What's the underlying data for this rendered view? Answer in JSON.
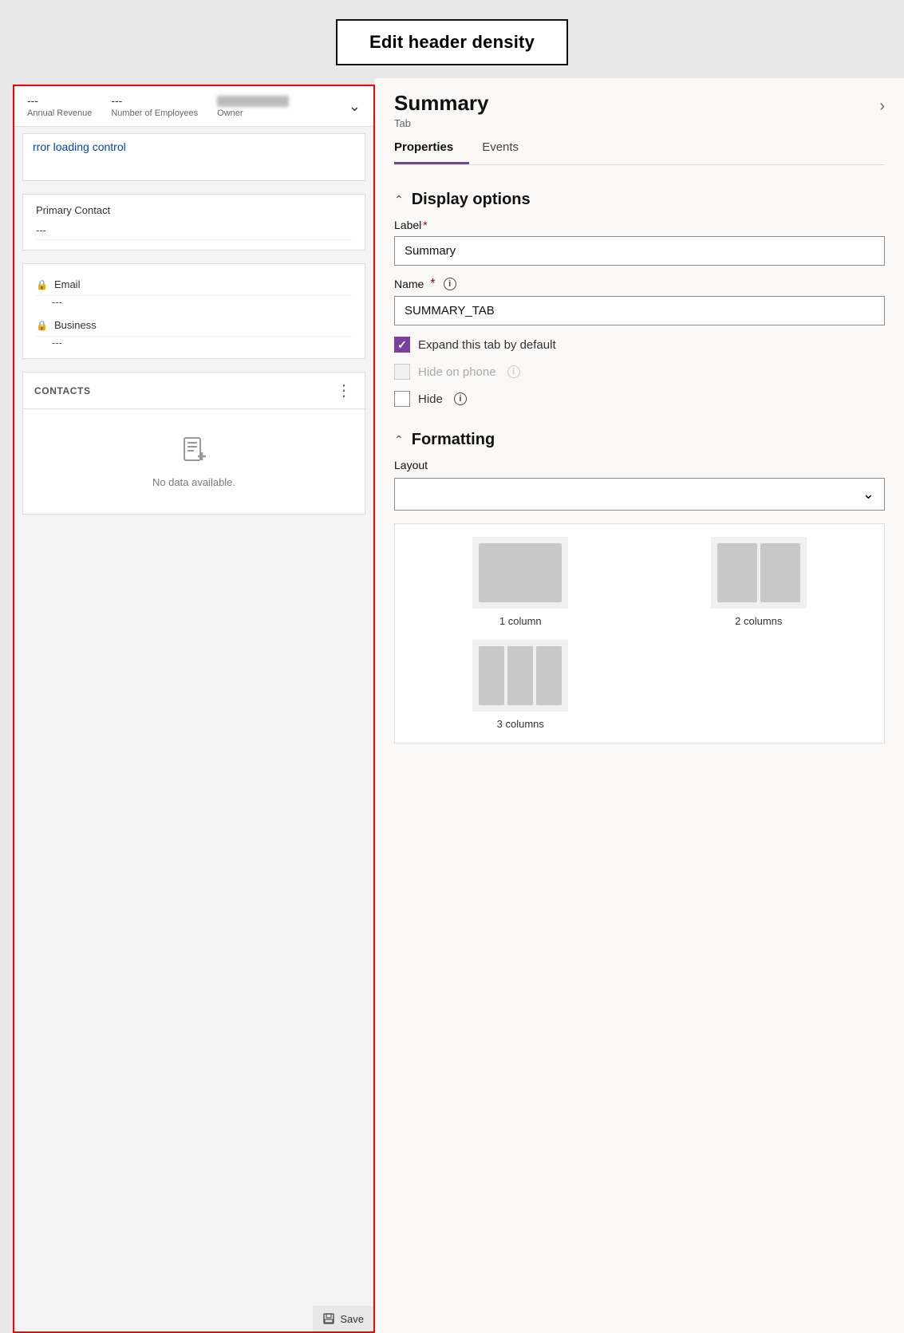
{
  "header": {
    "edit_button_label": "Edit header density"
  },
  "left_pane": {
    "header_fields": [
      {
        "value": "---",
        "label": "Annual Revenue"
      },
      {
        "value": "---",
        "label": "Number of Employees"
      },
      {
        "value": "",
        "label": "Owner",
        "is_blurred": true
      }
    ],
    "error_text": "rror loading control",
    "primary_contact": {
      "label": "Primary Contact",
      "value": "---"
    },
    "fields": [
      {
        "icon": "🔒",
        "name": "Email",
        "value": "---"
      },
      {
        "icon": "🔒",
        "name": "Business",
        "value": "---"
      }
    ],
    "contacts_section": {
      "label": "CONTACTS",
      "no_data_text": "No data available."
    },
    "save_label": "Save"
  },
  "right_pane": {
    "title": "Summary",
    "subtitle": "Tab",
    "tabs": [
      {
        "label": "Properties",
        "active": true
      },
      {
        "label": "Events",
        "active": false
      }
    ],
    "display_options": {
      "section_title": "Display options",
      "label_field": {
        "label": "Label",
        "required": true,
        "value": "Summary"
      },
      "name_field": {
        "label": "Name",
        "required": true,
        "value": "SUMMARY_TAB"
      },
      "expand_checkbox": {
        "label": "Expand this tab by default",
        "checked": true,
        "disabled": false
      },
      "hide_on_phone_checkbox": {
        "label": "Hide on phone",
        "checked": false,
        "disabled": true
      },
      "hide_checkbox": {
        "label": "Hide",
        "checked": false,
        "disabled": false
      }
    },
    "formatting": {
      "section_title": "Formatting",
      "layout_label": "Layout",
      "options": [
        {
          "id": "1col",
          "label": "1 column",
          "cols": 1
        },
        {
          "id": "2col",
          "label": "2 columns",
          "cols": 2
        },
        {
          "id": "3col",
          "label": "3 columns",
          "cols": 3
        }
      ]
    }
  }
}
